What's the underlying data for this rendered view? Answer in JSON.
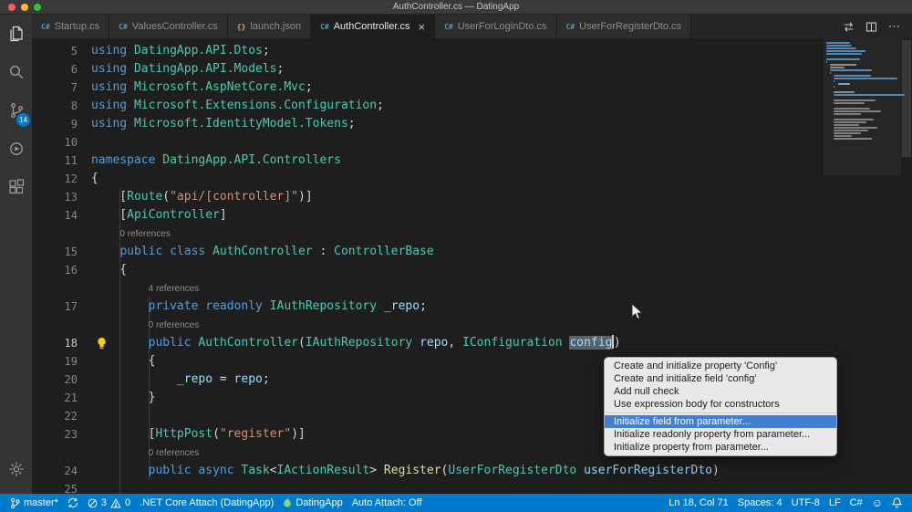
{
  "title_bar": {
    "title": "AuthController.cs — DatingApp"
  },
  "tabs": [
    {
      "glyph": "C#",
      "label": "Startup.cs"
    },
    {
      "glyph": "C#",
      "label": "ValuesController.cs"
    },
    {
      "glyph": "{}",
      "label": "launch.json"
    },
    {
      "glyph": "C#",
      "label": "AuthController.cs",
      "close": "×",
      "active": true
    },
    {
      "glyph": "C#",
      "label": "UserForLoginDto.cs"
    },
    {
      "glyph": "C#",
      "label": "UserForRegisterDto.cs"
    }
  ],
  "editor_actions": {
    "more": "⋯"
  },
  "activity_bar": {
    "scm_badge": "14"
  },
  "editor": {
    "rows": [
      {
        "n": "5",
        "tokens": [
          {
            "t": "using ",
            "c": "kw"
          },
          {
            "t": "DatingApp.API.Dtos",
            "c": "type"
          },
          {
            "t": ";",
            "c": "plain"
          }
        ]
      },
      {
        "n": "6",
        "tokens": [
          {
            "t": "using ",
            "c": "kw"
          },
          {
            "t": "DatingApp.API.Models",
            "c": "type"
          },
          {
            "t": ";",
            "c": "plain"
          }
        ]
      },
      {
        "n": "7",
        "tokens": [
          {
            "t": "using ",
            "c": "kw"
          },
          {
            "t": "Microsoft.AspNetCore.Mvc",
            "c": "type"
          },
          {
            "t": ";",
            "c": "plain"
          }
        ]
      },
      {
        "n": "8",
        "tokens": [
          {
            "t": "using ",
            "c": "kw"
          },
          {
            "t": "Microsoft.Extensions.Configuration",
            "c": "type"
          },
          {
            "t": ";",
            "c": "plain"
          }
        ]
      },
      {
        "n": "9",
        "tokens": [
          {
            "t": "using ",
            "c": "kw"
          },
          {
            "t": "Microsoft.IdentityModel.Tokens",
            "c": "type"
          },
          {
            "t": ";",
            "c": "plain"
          }
        ]
      },
      {
        "n": "10",
        "tokens": []
      },
      {
        "n": "11",
        "tokens": [
          {
            "t": "namespace ",
            "c": "kw"
          },
          {
            "t": "DatingApp.API.Controllers",
            "c": "type"
          }
        ]
      },
      {
        "n": "12",
        "tokens": [
          {
            "t": "{",
            "c": "plain"
          }
        ]
      },
      {
        "n": "13",
        "tokens": [
          {
            "t": "    [",
            "c": "plain"
          },
          {
            "t": "Route",
            "c": "type"
          },
          {
            "t": "(",
            "c": "plain"
          },
          {
            "t": "\"api/[controller]\"",
            "c": "str"
          },
          {
            "t": ")]",
            "c": "plain"
          }
        ]
      },
      {
        "n": "14",
        "tokens": [
          {
            "t": "    [",
            "c": "plain"
          },
          {
            "t": "ApiController",
            "c": "type"
          },
          {
            "t": "]",
            "c": "plain"
          }
        ]
      },
      {
        "lens": true,
        "indent": 4,
        "text": "0 references"
      },
      {
        "n": "15",
        "tokens": [
          {
            "t": "    ",
            "c": "plain"
          },
          {
            "t": "public class ",
            "c": "kw"
          },
          {
            "t": "AuthController",
            "c": "type"
          },
          {
            "t": " : ",
            "c": "plain"
          },
          {
            "t": "ControllerBase",
            "c": "type"
          }
        ]
      },
      {
        "n": "16",
        "tokens": [
          {
            "t": "    {",
            "c": "plain"
          }
        ]
      },
      {
        "lens": true,
        "indent": 8,
        "text": "4 references"
      },
      {
        "n": "17",
        "tokens": [
          {
            "t": "        ",
            "c": "plain"
          },
          {
            "t": "private readonly ",
            "c": "kw"
          },
          {
            "t": "IAuthRepository",
            "c": "type"
          },
          {
            "t": " ",
            "c": "plain"
          },
          {
            "t": "_repo",
            "c": "var"
          },
          {
            "t": ";",
            "c": "plain"
          }
        ]
      },
      {
        "lens": true,
        "indent": 8,
        "text": "0 references"
      },
      {
        "n": "18",
        "current": true,
        "bulb": true,
        "tokens": [
          {
            "t": "        ",
            "c": "plain"
          },
          {
            "t": "public ",
            "c": "kw"
          },
          {
            "t": "AuthController",
            "c": "type"
          },
          {
            "t": "(",
            "c": "plain"
          },
          {
            "t": "IAuthRepository",
            "c": "type"
          },
          {
            "t": " ",
            "c": "plain"
          },
          {
            "t": "repo",
            "c": "var"
          },
          {
            "t": ", ",
            "c": "plain"
          },
          {
            "t": "IConfiguration",
            "c": "type"
          },
          {
            "t": " ",
            "c": "plain"
          },
          {
            "t": "config",
            "c": "var",
            "hl": true,
            "caret": true
          },
          {
            "t": ")",
            "c": "plain"
          }
        ]
      },
      {
        "n": "19",
        "tokens": [
          {
            "t": "        {",
            "c": "plain"
          }
        ]
      },
      {
        "n": "20",
        "tokens": [
          {
            "t": "            ",
            "c": "plain"
          },
          {
            "t": "_repo",
            "c": "var"
          },
          {
            "t": " = ",
            "c": "plain"
          },
          {
            "t": "repo",
            "c": "var"
          },
          {
            "t": ";",
            "c": "plain"
          }
        ]
      },
      {
        "n": "21",
        "tokens": [
          {
            "t": "        }",
            "c": "plain"
          }
        ]
      },
      {
        "n": "22",
        "tokens": []
      },
      {
        "n": "23",
        "tokens": [
          {
            "t": "        [",
            "c": "plain"
          },
          {
            "t": "HttpPost",
            "c": "type"
          },
          {
            "t": "(",
            "c": "plain"
          },
          {
            "t": "\"register\"",
            "c": "str"
          },
          {
            "t": ")]",
            "c": "plain"
          }
        ]
      },
      {
        "lens": true,
        "indent": 8,
        "text": "0 references"
      },
      {
        "n": "24",
        "tokens": [
          {
            "t": "        ",
            "c": "plain"
          },
          {
            "t": "public async ",
            "c": "kw"
          },
          {
            "t": "Task",
            "c": "type"
          },
          {
            "t": "<",
            "c": "plain"
          },
          {
            "t": "IActionResult",
            "c": "type"
          },
          {
            "t": "> ",
            "c": "plain"
          },
          {
            "t": "Register",
            "c": "method"
          },
          {
            "t": "(",
            "c": "plain"
          },
          {
            "t": "UserForRegisterDto",
            "c": "type"
          },
          {
            "t": " ",
            "c": "plain"
          },
          {
            "t": "userForRegisterDto",
            "c": "var"
          },
          {
            "t": ")",
            "c": "plain"
          }
        ]
      },
      {
        "n": "25",
        "tokens": []
      }
    ]
  },
  "context_menu": {
    "items": [
      {
        "label": "Create and initialize property 'Config'"
      },
      {
        "label": "Create and initialize field 'config'"
      },
      {
        "label": "Add null check"
      },
      {
        "label": "Use expression body for constructors"
      },
      {
        "label": "Initialize field from parameter...",
        "highlighted": true
      },
      {
        "label": "Initialize readonly property from parameter..."
      },
      {
        "label": "Initialize property from parameter..."
      }
    ]
  },
  "status_bar": {
    "branch": "master*",
    "errors": "3",
    "warnings": "0",
    "debug_config": ".NET Core Attach (DatingApp)",
    "project": "DatingApp",
    "auto_attach": "Auto Attach: Off",
    "line_col": "Ln 18, Col 71",
    "indentation": "Spaces: 4",
    "encoding": "UTF-8",
    "eol": "LF",
    "language": "C#",
    "smiley": "☺"
  },
  "colors": {
    "status_bar": "#007acc",
    "badge": "#007acc",
    "menu_highlight": "#417fd4",
    "keyword": "#569cd6",
    "type": "#4ec9b0",
    "string": "#ce9178",
    "variable": "#9cdcfe",
    "method": "#dcdcaa",
    "lightbulb": "#ffcc00",
    "traffic_lights": [
      "#ff5f57",
      "#febc2e",
      "#28c840"
    ]
  }
}
